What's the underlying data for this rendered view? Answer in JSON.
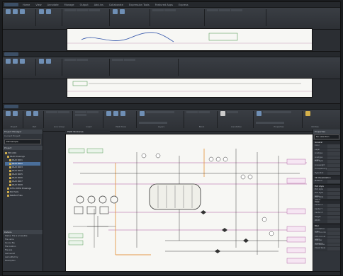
{
  "back_window": {
    "menu_tabs": [
      "Home",
      "View",
      "Annotate",
      "Manage",
      "Output",
      "Add-ins",
      "Collaborate",
      "Expression Tools",
      "Featured Apps",
      "Express"
    ]
  },
  "main_window": {
    "ribbon_groups": [
      {
        "name": "Project",
        "buttons": [
          "Project Manager",
          "Data Manager"
        ]
      },
      {
        "name": "Part",
        "buttons": [
          "P&ID Assign Tag",
          "Show Tag"
        ]
      },
      {
        "name": "Line Group",
        "buttons": [
          "Schematic Line"
        ]
      },
      {
        "name": "Insert",
        "buttons": [
          "Draw",
          "Match"
        ]
      },
      {
        "name": "P&ID Tools"
      },
      {
        "name": "Layers"
      },
      {
        "name": "Block"
      },
      {
        "name": "Annotation"
      },
      {
        "name": "Properties"
      },
      {
        "name": "Utilities"
      }
    ],
    "canvas_tab": "P&ID Workarea",
    "left_panel": {
      "title": "Project Manager",
      "current_project_label": "Current Project",
      "project_value": "PIP Sample",
      "section": "Project",
      "tree": [
        {
          "label": "PIP-1001",
          "level": 0
        },
        {
          "label": "P&ID Drawings",
          "level": 1
        },
        {
          "label": "P&ID 0001",
          "level": 2
        },
        {
          "label": "P&ID 0002",
          "level": 2,
          "selected": true
        },
        {
          "label": "P&ID 0003",
          "level": 2
        },
        {
          "label": "P&ID 0004",
          "level": 2
        },
        {
          "label": "P&ID 0005",
          "level": 2
        },
        {
          "label": "P&ID 0006",
          "level": 2
        },
        {
          "label": "P&ID 0007",
          "level": 2
        },
        {
          "label": "P&ID 0008",
          "level": 2
        },
        {
          "label": "Ortho DWG Drawings",
          "level": 1
        },
        {
          "label": "Plot Sets",
          "level": 1
        },
        {
          "label": "Related Files",
          "level": 1
        }
      ],
      "details_title": "Details",
      "details": [
        "Status: File is accessible",
        "File name",
        "Source file",
        "File location",
        "File size",
        "Last saved",
        "Last edited by",
        "Description"
      ]
    },
    "right_panel": {
      "title": "Properties",
      "selection": "No selection",
      "sections": [
        {
          "name": "General",
          "rows": [
            "Color",
            "Layer",
            "Linetype",
            "Linetype scale",
            "Plot style",
            "Lineweight",
            "Transparency",
            "Hyperlink"
          ]
        },
        {
          "name": "3D Visualization",
          "rows": [
            "Material"
          ]
        },
        {
          "name": "Plot style",
          "rows": [
            "Plot style",
            "Plot style table",
            "Plot table attach"
          ]
        },
        {
          "name": "View",
          "rows": [
            "Center X",
            "Center Y",
            "Center Z",
            "Height",
            "Width"
          ]
        },
        {
          "name": "Misc",
          "rows": [
            "Annotation scale",
            "UCS icon On",
            "UCS icon at origin",
            "UCS per viewport",
            "UCS Name",
            "Visual Style"
          ]
        }
      ]
    }
  }
}
